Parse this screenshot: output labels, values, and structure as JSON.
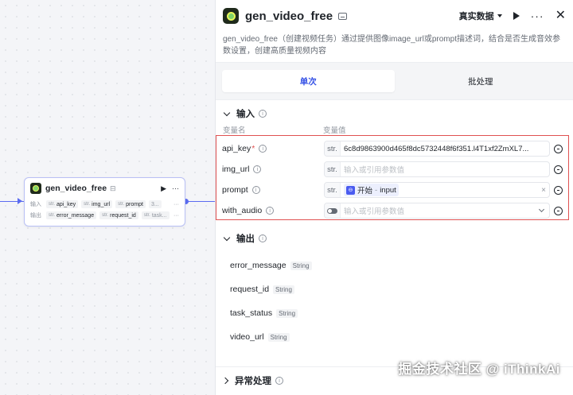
{
  "node": {
    "title": "gen_video_free",
    "input_label": "输入",
    "output_label": "输出",
    "inputs": [
      {
        "type": "str.",
        "name": "api_key"
      },
      {
        "type": "str.",
        "name": "img_url"
      },
      {
        "type": "str.",
        "name": "prompt"
      },
      {
        "type": "",
        "name": "3..."
      }
    ],
    "outputs": [
      {
        "type": "str.",
        "name": "error_message"
      },
      {
        "type": "str.",
        "name": "request_id"
      },
      {
        "type": "str.",
        "name": "task..."
      }
    ],
    "more": "···"
  },
  "panel": {
    "title": "gen_video_free",
    "mode_label": "真实数据",
    "more": "···",
    "close": "✕",
    "description": "gen_video_free（创建视频任务）通过提供图像image_url或prompt描述词，结合是否生成音效参数设置，创建高质量视频内容",
    "tabs": [
      {
        "label": "单次",
        "active": true
      },
      {
        "label": "批处理",
        "active": false
      }
    ],
    "input_section": {
      "title": "输入",
      "col_name": "变量名",
      "col_value": "变量值",
      "rows": [
        {
          "name": "api_key",
          "required": "*",
          "type": "str.",
          "value": "6c8d9863900d465f8dc5732448f6f351.l4T1xf2ZmXL7..."
        },
        {
          "name": "img_url",
          "type": "str.",
          "placeholder": "输入或引用参数值"
        },
        {
          "name": "prompt",
          "type": "str.",
          "ref_source": "开始",
          "ref_sep": " - ",
          "ref_field": "input",
          "clear": "×"
        },
        {
          "name": "with_audio",
          "placeholder": "输入或引用参数值"
        }
      ]
    },
    "output_section": {
      "title": "输出",
      "items": [
        {
          "name": "error_message",
          "type": "String"
        },
        {
          "name": "request_id",
          "type": "String"
        },
        {
          "name": "task_status",
          "type": "String"
        },
        {
          "name": "video_url",
          "type": "String"
        }
      ]
    },
    "exception_section": {
      "title": "异常处理"
    }
  },
  "watermark": "掘金技术社区 @ iThinkAi",
  "colors": {
    "accent": "#3450e5",
    "highlight_border": "#e05252",
    "connector": "#5b6cf0"
  }
}
